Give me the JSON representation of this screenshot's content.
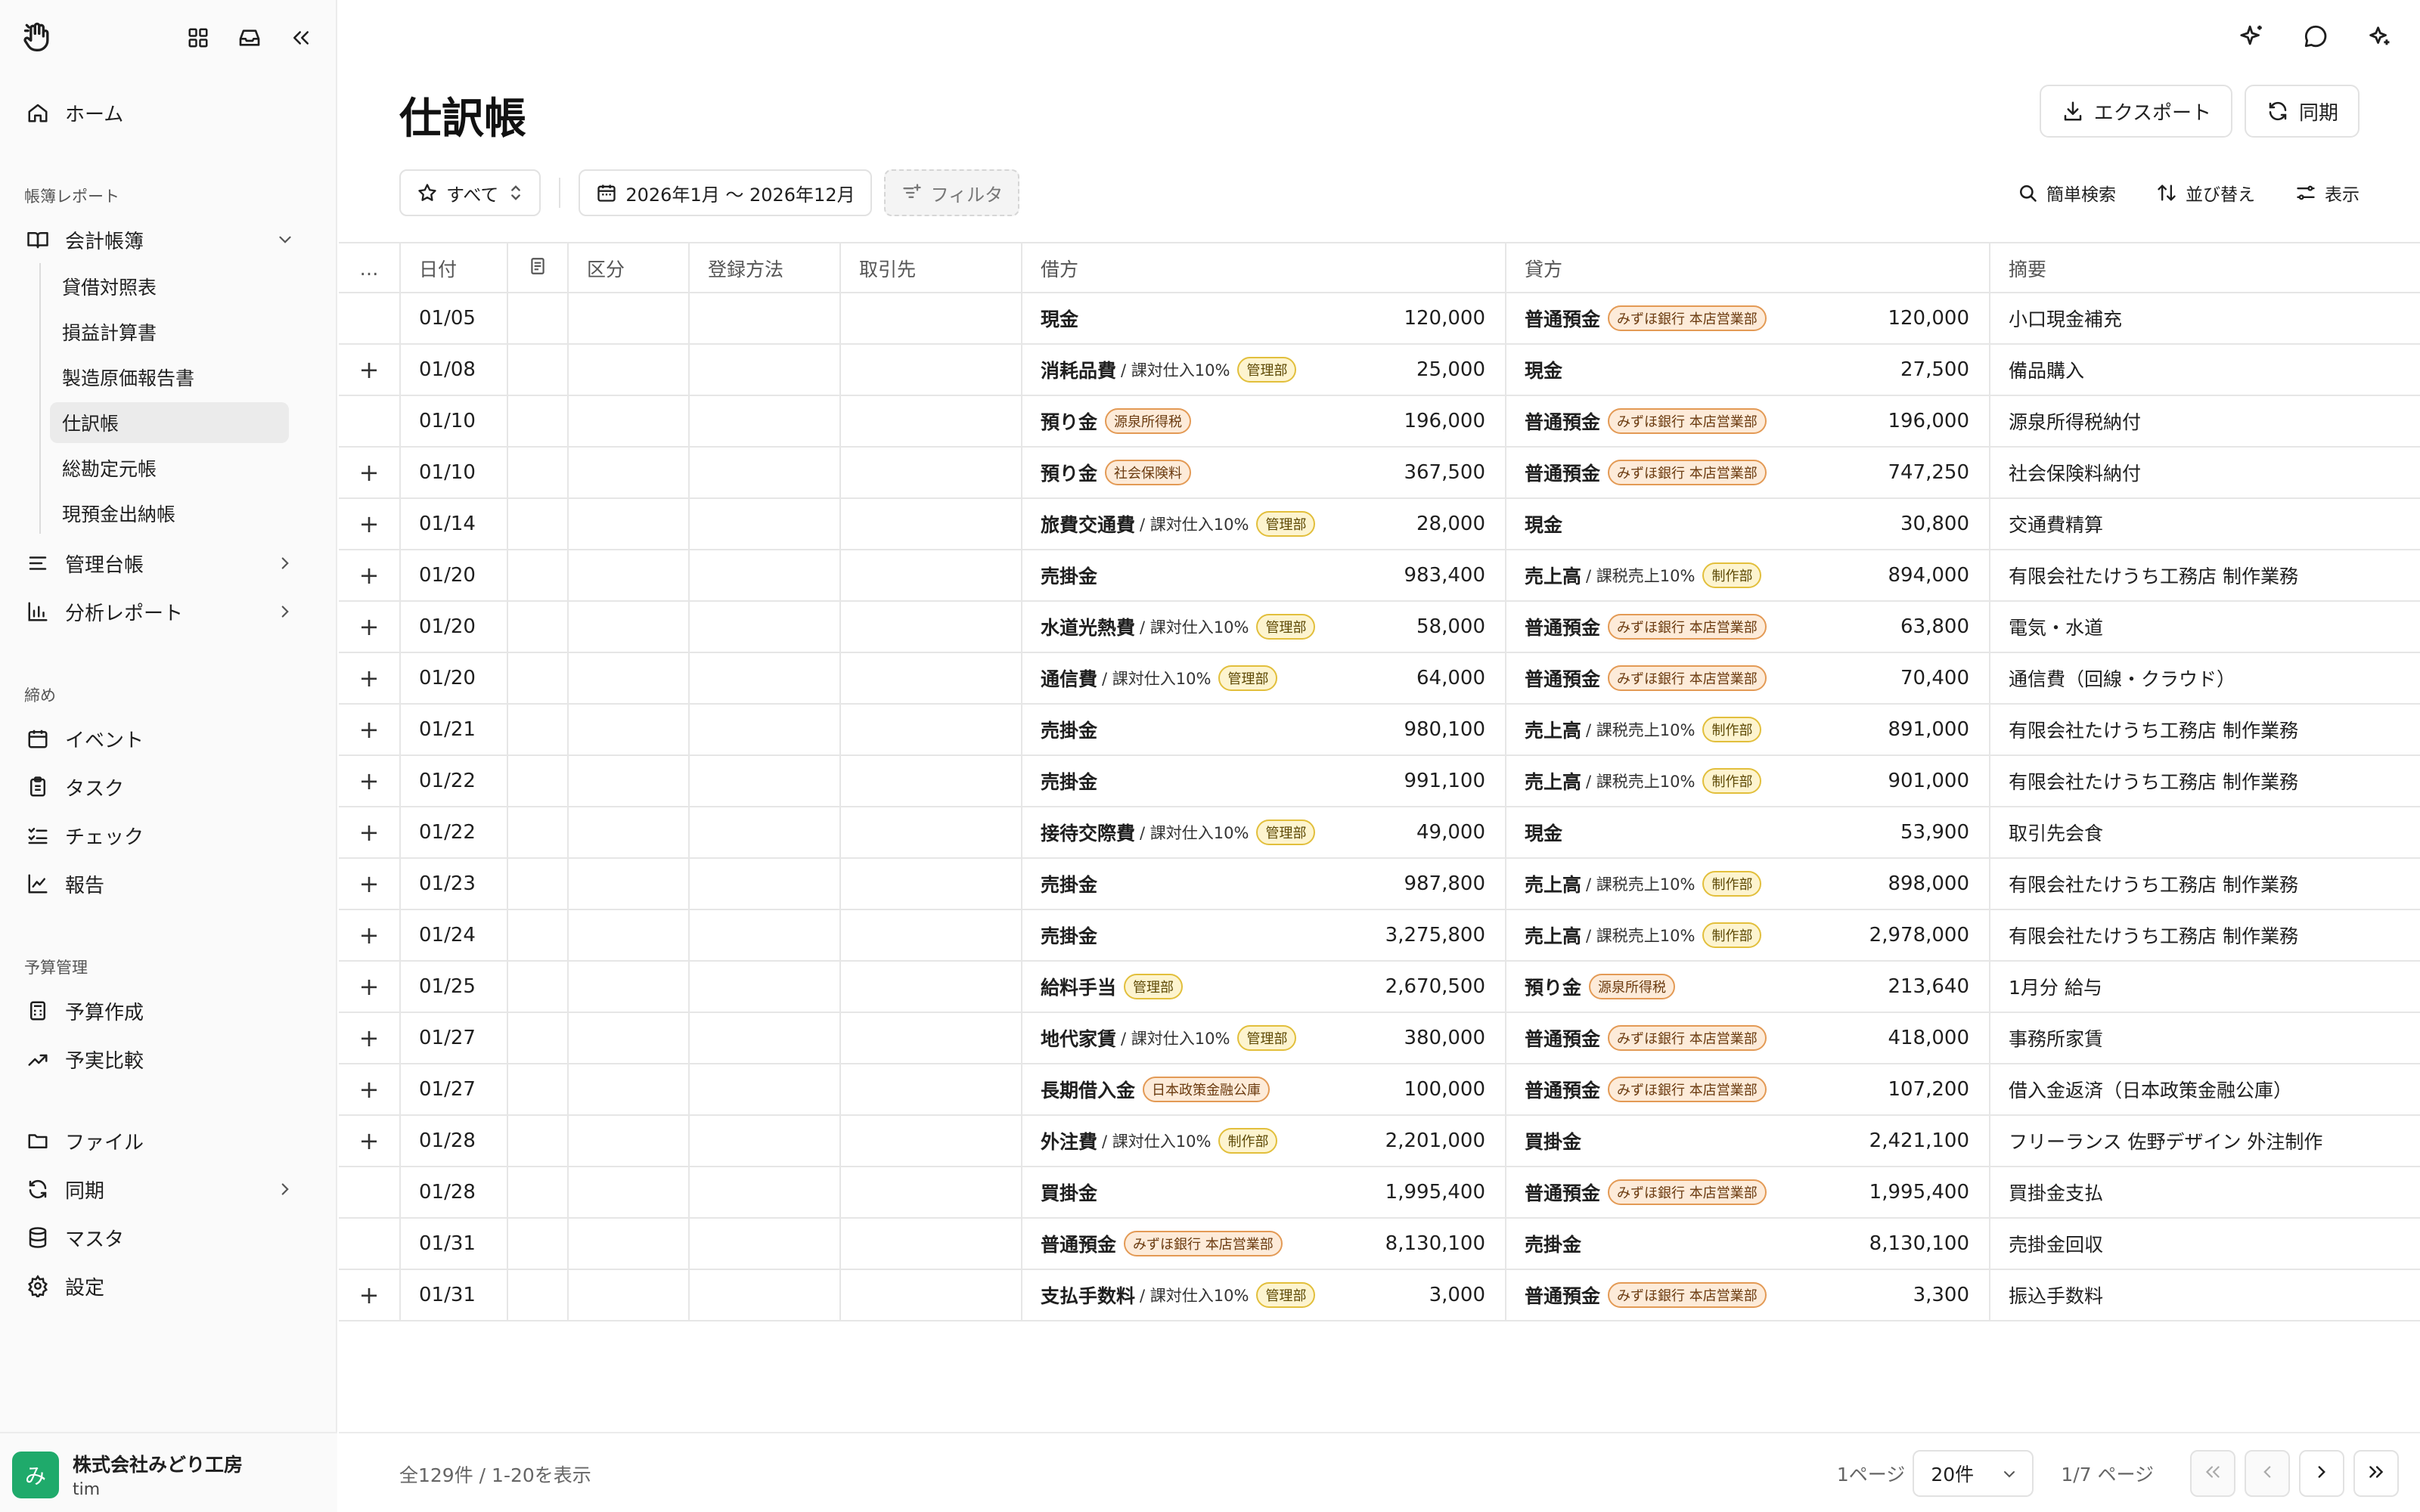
{
  "sidebar": {
    "home": "ホーム",
    "section_reports": "帳簿レポート",
    "accounting_books": "会計帳簿",
    "sub_items": [
      "貸借対照表",
      "損益計算書",
      "製造原価報告書",
      "仕訳帳",
      "総勘定元帳",
      "現預金出納帳"
    ],
    "management_ledger": "管理台帳",
    "analysis_reports": "分析レポート",
    "section_closing": "締め",
    "closing_items": [
      "イベント",
      "タスク",
      "チェック",
      "報告"
    ],
    "section_budget": "予算管理",
    "budget_items": [
      "予算作成",
      "予実比較"
    ],
    "files": "ファイル",
    "sync": "同期",
    "master": "マスタ",
    "settings": "設定",
    "org_initial": "み",
    "org_name": "株式会社みどり工房",
    "user": "tim"
  },
  "header": {
    "title": "仕訳帳",
    "export_label": "エクスポート",
    "sync_label": "同期"
  },
  "toolbar": {
    "view_filter": "すべて",
    "date_range": "2026年1月 〜 2026年12月",
    "filter": "フィルタ",
    "quick_search": "簡単検索",
    "sort": "並び替え",
    "display": "表示"
  },
  "table": {
    "columns": [
      "…",
      "日付",
      "",
      "区分",
      "登録方法",
      "取引先",
      "借方",
      "貸方",
      "摘要"
    ],
    "rows": [
      {
        "plus": "",
        "date": "01/05",
        "dr": {
          "name": "現金",
          "tax": "",
          "tag": "",
          "tag_type": "",
          "amount": "120,000"
        },
        "cr": {
          "name": "普通預金",
          "tax": "",
          "tag": "みずほ銀行 本店営業部",
          "tag_type": "bank",
          "amount": "120,000"
        },
        "memo": "小口現金補充"
      },
      {
        "plus": "+",
        "date": "01/08",
        "dr": {
          "name": "消耗品費",
          "tax": "/ 課対仕入10%",
          "tag": "管理部",
          "tag_type": "dept",
          "amount": "25,000"
        },
        "cr": {
          "name": "現金",
          "tax": "",
          "tag": "",
          "tag_type": "",
          "amount": "27,500"
        },
        "memo": "備品購入"
      },
      {
        "plus": "",
        "date": "01/10",
        "dr": {
          "name": "預り金",
          "tax": "",
          "tag": "源泉所得税",
          "tag_type": "bank",
          "amount": "196,000"
        },
        "cr": {
          "name": "普通預金",
          "tax": "",
          "tag": "みずほ銀行 本店営業部",
          "tag_type": "bank",
          "amount": "196,000"
        },
        "memo": "源泉所得税納付"
      },
      {
        "plus": "+",
        "date": "01/10",
        "dr": {
          "name": "預り金",
          "tax": "",
          "tag": "社会保険料",
          "tag_type": "bank",
          "amount": "367,500"
        },
        "cr": {
          "name": "普通預金",
          "tax": "",
          "tag": "みずほ銀行 本店営業部",
          "tag_type": "bank",
          "amount": "747,250"
        },
        "memo": "社会保険料納付"
      },
      {
        "plus": "+",
        "date": "01/14",
        "dr": {
          "name": "旅費交通費",
          "tax": "/ 課対仕入10%",
          "tag": "管理部",
          "tag_type": "dept",
          "amount": "28,000"
        },
        "cr": {
          "name": "現金",
          "tax": "",
          "tag": "",
          "tag_type": "",
          "amount": "30,800"
        },
        "memo": "交通費精算"
      },
      {
        "plus": "+",
        "date": "01/20",
        "dr": {
          "name": "売掛金",
          "tax": "",
          "tag": "",
          "tag_type": "",
          "amount": "983,400"
        },
        "cr": {
          "name": "売上高",
          "tax": "/ 課税売上10%",
          "tag": "制作部",
          "tag_type": "dept",
          "amount": "894,000"
        },
        "memo": "有限会社たけうち工務店 制作業務"
      },
      {
        "plus": "+",
        "date": "01/20",
        "dr": {
          "name": "水道光熱費",
          "tax": "/ 課対仕入10%",
          "tag": "管理部",
          "tag_type": "dept",
          "amount": "58,000"
        },
        "cr": {
          "name": "普通預金",
          "tax": "",
          "tag": "みずほ銀行 本店営業部",
          "tag_type": "bank",
          "amount": "63,800"
        },
        "memo": "電気・水道"
      },
      {
        "plus": "+",
        "date": "01/20",
        "dr": {
          "name": "通信費",
          "tax": "/ 課対仕入10%",
          "tag": "管理部",
          "tag_type": "dept",
          "amount": "64,000"
        },
        "cr": {
          "name": "普通預金",
          "tax": "",
          "tag": "みずほ銀行 本店営業部",
          "tag_type": "bank",
          "amount": "70,400"
        },
        "memo": "通信費（回線・クラウド）"
      },
      {
        "plus": "+",
        "date": "01/21",
        "dr": {
          "name": "売掛金",
          "tax": "",
          "tag": "",
          "tag_type": "",
          "amount": "980,100"
        },
        "cr": {
          "name": "売上高",
          "tax": "/ 課税売上10%",
          "tag": "制作部",
          "tag_type": "dept",
          "amount": "891,000"
        },
        "memo": "有限会社たけうち工務店 制作業務"
      },
      {
        "plus": "+",
        "date": "01/22",
        "dr": {
          "name": "売掛金",
          "tax": "",
          "tag": "",
          "tag_type": "",
          "amount": "991,100"
        },
        "cr": {
          "name": "売上高",
          "tax": "/ 課税売上10%",
          "tag": "制作部",
          "tag_type": "dept",
          "amount": "901,000"
        },
        "memo": "有限会社たけうち工務店 制作業務"
      },
      {
        "plus": "+",
        "date": "01/22",
        "dr": {
          "name": "接待交際費",
          "tax": "/ 課対仕入10%",
          "tag": "管理部",
          "tag_type": "dept",
          "amount": "49,000"
        },
        "cr": {
          "name": "現金",
          "tax": "",
          "tag": "",
          "tag_type": "",
          "amount": "53,900"
        },
        "memo": "取引先会食"
      },
      {
        "plus": "+",
        "date": "01/23",
        "dr": {
          "name": "売掛金",
          "tax": "",
          "tag": "",
          "tag_type": "",
          "amount": "987,800"
        },
        "cr": {
          "name": "売上高",
          "tax": "/ 課税売上10%",
          "tag": "制作部",
          "tag_type": "dept",
          "amount": "898,000"
        },
        "memo": "有限会社たけうち工務店 制作業務"
      },
      {
        "plus": "+",
        "date": "01/24",
        "dr": {
          "name": "売掛金",
          "tax": "",
          "tag": "",
          "tag_type": "",
          "amount": "3,275,800"
        },
        "cr": {
          "name": "売上高",
          "tax": "/ 課税売上10%",
          "tag": "制作部",
          "tag_type": "dept",
          "amount": "2,978,000"
        },
        "memo": "有限会社たけうち工務店 制作業務"
      },
      {
        "plus": "+",
        "date": "01/25",
        "dr": {
          "name": "給料手当",
          "tax": "",
          "tag": "管理部",
          "tag_type": "dept",
          "amount": "2,670,500"
        },
        "cr": {
          "name": "預り金",
          "tax": "",
          "tag": "源泉所得税",
          "tag_type": "bank",
          "amount": "213,640"
        },
        "memo": "1月分 給与"
      },
      {
        "plus": "+",
        "date": "01/27",
        "dr": {
          "name": "地代家賃",
          "tax": "/ 課対仕入10%",
          "tag": "管理部",
          "tag_type": "dept",
          "amount": "380,000"
        },
        "cr": {
          "name": "普通預金",
          "tax": "",
          "tag": "みずほ銀行 本店営業部",
          "tag_type": "bank",
          "amount": "418,000"
        },
        "memo": "事務所家賃"
      },
      {
        "plus": "+",
        "date": "01/27",
        "dr": {
          "name": "長期借入金",
          "tax": "",
          "tag": "日本政策金融公庫",
          "tag_type": "bank",
          "amount": "100,000"
        },
        "cr": {
          "name": "普通預金",
          "tax": "",
          "tag": "みずほ銀行 本店営業部",
          "tag_type": "bank",
          "amount": "107,200"
        },
        "memo": "借入金返済（日本政策金融公庫）"
      },
      {
        "plus": "+",
        "date": "01/28",
        "dr": {
          "name": "外注費",
          "tax": "/ 課対仕入10%",
          "tag": "制作部",
          "tag_type": "dept",
          "amount": "2,201,000"
        },
        "cr": {
          "name": "買掛金",
          "tax": "",
          "tag": "",
          "tag_type": "",
          "amount": "2,421,100"
        },
        "memo": "フリーランス 佐野デザイン 外注制作"
      },
      {
        "plus": "",
        "date": "01/28",
        "dr": {
          "name": "買掛金",
          "tax": "",
          "tag": "",
          "tag_type": "",
          "amount": "1,995,400"
        },
        "cr": {
          "name": "普通預金",
          "tax": "",
          "tag": "みずほ銀行 本店営業部",
          "tag_type": "bank",
          "amount": "1,995,400"
        },
        "memo": "買掛金支払"
      },
      {
        "plus": "",
        "date": "01/31",
        "dr": {
          "name": "普通預金",
          "tax": "",
          "tag": "みずほ銀行 本店営業部",
          "tag_type": "bank",
          "amount": "8,130,100"
        },
        "cr": {
          "name": "売掛金",
          "tax": "",
          "tag": "",
          "tag_type": "",
          "amount": "8,130,100"
        },
        "memo": "売掛金回収"
      },
      {
        "plus": "+",
        "date": "01/31",
        "dr": {
          "name": "支払手数料",
          "tax": "/ 課対仕入10%",
          "tag": "管理部",
          "tag_type": "dept",
          "amount": "3,000"
        },
        "cr": {
          "name": "普通預金",
          "tax": "",
          "tag": "みずほ銀行 本店営業部",
          "tag_type": "bank",
          "amount": "3,300"
        },
        "memo": "振込手数料"
      }
    ]
  },
  "footer": {
    "count_text": "全129件 / 1-20を表示",
    "page_label": "1ページ",
    "page_size": "20件",
    "page_indicator": "1/7 ページ"
  },
  "colors": {
    "bank_tag_border": "#e39a55",
    "dept_tag_border": "#e2bf3c",
    "avatar": "#1faa6b"
  }
}
